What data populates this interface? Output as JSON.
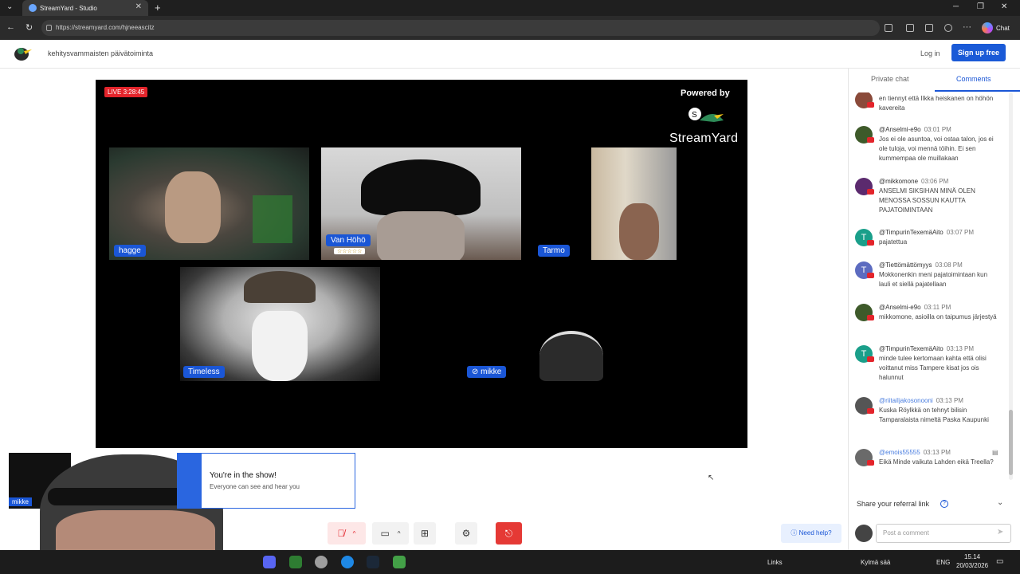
{
  "browser": {
    "tab_title": "StreamYard - Studio",
    "url": "https://streamyard.com/hjneeascitz",
    "chat_label": "Chat"
  },
  "header": {
    "room_title": "kehitysvammaisten päivätoiminta",
    "login": "Log in",
    "signup": "Sign up free"
  },
  "stage": {
    "live_badge": "LIVE 3:28:45",
    "powered_by": "Powered by",
    "brand": "StreamYard",
    "participants": [
      {
        "name": "hagge"
      },
      {
        "name": "Van Höhö",
        "badge": "☆☆☆☆☆"
      },
      {
        "name": "Tarmo"
      },
      {
        "name": "Timeless"
      },
      {
        "name": "mikke",
        "muted": true
      }
    ]
  },
  "self_view": {
    "name": "mikke"
  },
  "toast": {
    "title": "You're in the show!",
    "subtitle": "Everyone can see and hear you"
  },
  "controls": {
    "need_help": "Need help?"
  },
  "panel": {
    "tabs": [
      "Private chat",
      "Comments"
    ],
    "active_tab": "Comments",
    "comments": [
      {
        "author": "",
        "time": "",
        "text": "en tiennyt että Ilkka heiskanen on höhön kavereita",
        "avatar_color": "#8a4a3a",
        "avatar_letter": ""
      },
      {
        "author": "@Anselmi-e9o",
        "time": "03:01 PM",
        "text": "Jos ei ole asuntoa, voi ostaa talon, jos ei ole tuloja, voi mennä töihin. Ei sen kummempaa ole muillakaan",
        "avatar_color": "#3e5a2a",
        "avatar_letter": ""
      },
      {
        "author": "@mikkomone",
        "time": "03:06 PM",
        "text": "ANSELMI SIKSIHAN MINÄ OLEN MENOSSA SOSSUN KAUTTA PAJATOIMINTAAN",
        "avatar_color": "#5b2a6e",
        "avatar_letter": ""
      },
      {
        "author": "@TimpurinTexemäAito",
        "time": "03:07 PM",
        "text": "pajatettua",
        "avatar_color": "#1a9f8a",
        "avatar_letter": "T"
      },
      {
        "author": "@Tiettömättömyys",
        "time": "03:08 PM",
        "text": "Mokkonenkin meni pajatoimintaan kun lauli et siellä pajatellaan",
        "avatar_color": "#5c6bc0",
        "avatar_letter": "T"
      },
      {
        "author": "@Anselmi-e9o",
        "time": "03:11 PM",
        "text": "mikkomone, asioilla on taipumus järjestyä",
        "avatar_color": "#3e5a2a",
        "avatar_letter": ""
      },
      {
        "author": "@TimpurinTexemäAito",
        "time": "03:13 PM",
        "text": "minde tulee kertomaan kahta että olisi voittanut miss Tampere kisat jos ois halunnut",
        "avatar_color": "#1a9f8a",
        "avatar_letter": "T"
      },
      {
        "author": "@riitaiIjakosonooni",
        "time": "03:13 PM",
        "text": "Kuska Röylkkä on tehnyt bilisin Tamparalaista nimeltä Paska Kaupunki",
        "avatar_color": "#555555",
        "avatar_letter": "",
        "author_blue": true
      },
      {
        "author": "@emois55555",
        "time": "03:13 PM",
        "text": "Eikä Minde vaikuta Lahden eikä Treella?",
        "avatar_color": "#6a6a6a",
        "avatar_letter": "",
        "author_blue": true
      }
    ],
    "referral": "Share your referral link",
    "comment_placeholder": "Post a comment"
  },
  "taskbar": {
    "links": "Links",
    "weather": "Kylmä sää",
    "lang": "ENG",
    "time": "15.14",
    "date": "20/03/2026"
  },
  "colors": {
    "brand_blue": "#1a56d6",
    "live_red": "#e3242b",
    "leave_red": "#e53935"
  }
}
